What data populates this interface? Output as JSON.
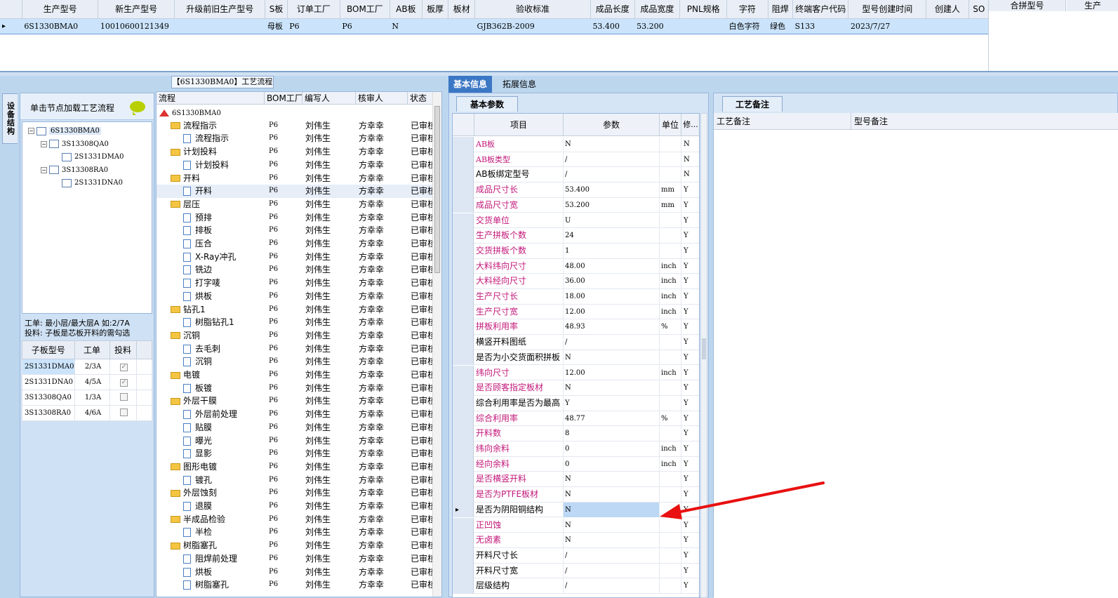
{
  "top_table": {
    "columns": [
      "生产型号",
      "新生产型号",
      "升级前旧生产型号",
      "S板",
      "订单工厂",
      "BOM工厂",
      "AB板",
      "板厚",
      "板材",
      "验收标准",
      "成品长度",
      "成品宽度",
      "PNL规格",
      "字符",
      "阻焊",
      "终端客户代码",
      "型号创建时间",
      "创建人",
      "SO"
    ],
    "row": [
      "6S1330BMA0",
      "10010600121349",
      "",
      "母板",
      "P6",
      "P6",
      "N",
      "",
      "",
      "GJB362B-2009",
      "53.400",
      "53.200",
      "",
      "白色字符",
      "绿色",
      "S133",
      "2023/7/27",
      "",
      ""
    ],
    "right_columns": [
      "合拼型号",
      "生产"
    ]
  },
  "left": {
    "side_tab": "设备结构",
    "hint": "单击节点加载工艺流程",
    "tree": [
      {
        "label": "6S1330BMA0",
        "level": 0
      },
      {
        "label": "3S13308QA0",
        "level": 1
      },
      {
        "label": "2S1331DMA0",
        "level": 2
      },
      {
        "label": "3S13308RA0",
        "level": 1
      },
      {
        "label": "2S1331DNA0",
        "level": 2
      }
    ],
    "note1": "工单: 最小层/最大层A 如:2/7A",
    "note2": "投料: 子板是芯板开料的需勾选",
    "sub_columns": [
      "子板型号",
      "工单",
      "投料"
    ],
    "sub_rows": [
      {
        "model": "2S1331DMA0",
        "order": "2/3A",
        "checked": true
      },
      {
        "model": "2S1331DNA0",
        "order": "4/5A",
        "checked": true
      },
      {
        "model": "3S13308QA0",
        "order": "1/3A",
        "checked": false
      },
      {
        "model": "3S13308RA0",
        "order": "4/6A",
        "checked": false
      }
    ]
  },
  "flow": {
    "title": "【6S1330BMA0】工艺流程",
    "columns": [
      "流程",
      "BOM工厂",
      "编写人",
      "核审人",
      "状态"
    ],
    "rows": [
      {
        "name": "6S1330BMA0",
        "type": "root",
        "bom": "",
        "writer": "",
        "reviewer": "",
        "status": ""
      },
      {
        "name": "流程指示",
        "type": "folder",
        "bom": "P6",
        "writer": "刘伟生",
        "reviewer": "方幸幸",
        "status": "已审核"
      },
      {
        "name": "流程指示",
        "type": "doc",
        "bom": "P6",
        "writer": "刘伟生",
        "reviewer": "方幸幸",
        "status": "已审核"
      },
      {
        "name": "计划投料",
        "type": "folder",
        "bom": "P6",
        "writer": "刘伟生",
        "reviewer": "方幸幸",
        "status": "已审核"
      },
      {
        "name": "计划投料",
        "type": "doc",
        "bom": "P6",
        "writer": "刘伟生",
        "reviewer": "方幸幸",
        "status": "已审核"
      },
      {
        "name": "开料",
        "type": "folder",
        "bom": "P6",
        "writer": "刘伟生",
        "reviewer": "方幸幸",
        "status": "已审核"
      },
      {
        "name": "开料",
        "type": "doc",
        "bom": "P6",
        "writer": "刘伟生",
        "reviewer": "方幸幸",
        "status": "已审核",
        "hl": true
      },
      {
        "name": "层压",
        "type": "folder",
        "bom": "P6",
        "writer": "刘伟生",
        "reviewer": "方幸幸",
        "status": "已审核"
      },
      {
        "name": "预排",
        "type": "doc",
        "bom": "P6",
        "writer": "刘伟生",
        "reviewer": "方幸幸",
        "status": "已审核"
      },
      {
        "name": "排板",
        "type": "doc",
        "bom": "P6",
        "writer": "刘伟生",
        "reviewer": "方幸幸",
        "status": "已审核"
      },
      {
        "name": "压合",
        "type": "doc",
        "bom": "P6",
        "writer": "刘伟生",
        "reviewer": "方幸幸",
        "status": "已审核"
      },
      {
        "name": "X-Ray冲孔",
        "type": "doc",
        "bom": "P6",
        "writer": "刘伟生",
        "reviewer": "方幸幸",
        "status": "已审核"
      },
      {
        "name": "铣边",
        "type": "doc",
        "bom": "P6",
        "writer": "刘伟生",
        "reviewer": "方幸幸",
        "status": "已审核"
      },
      {
        "name": "打字唛",
        "type": "doc",
        "bom": "P6",
        "writer": "刘伟生",
        "reviewer": "方幸幸",
        "status": "已审核"
      },
      {
        "name": "烘板",
        "type": "doc",
        "bom": "P6",
        "writer": "刘伟生",
        "reviewer": "方幸幸",
        "status": "已审核"
      },
      {
        "name": "钻孔1",
        "type": "folder",
        "bom": "P6",
        "writer": "刘伟生",
        "reviewer": "方幸幸",
        "status": "已审核"
      },
      {
        "name": "树脂钻孔1",
        "type": "doc",
        "bom": "P6",
        "writer": "刘伟生",
        "reviewer": "方幸幸",
        "status": "已审核"
      },
      {
        "name": "沉铜",
        "type": "folder",
        "bom": "P6",
        "writer": "刘伟生",
        "reviewer": "方幸幸",
        "status": "已审核"
      },
      {
        "name": "去毛刺",
        "type": "doc",
        "bom": "P6",
        "writer": "刘伟生",
        "reviewer": "方幸幸",
        "status": "已审核"
      },
      {
        "name": "沉铜",
        "type": "doc",
        "bom": "P6",
        "writer": "刘伟生",
        "reviewer": "方幸幸",
        "status": "已审核"
      },
      {
        "name": "电镀",
        "type": "folder",
        "bom": "P6",
        "writer": "刘伟生",
        "reviewer": "方幸幸",
        "status": "已审核"
      },
      {
        "name": "板镀",
        "type": "doc",
        "bom": "P6",
        "writer": "刘伟生",
        "reviewer": "方幸幸",
        "status": "已审核"
      },
      {
        "name": "外层干膜",
        "type": "folder",
        "bom": "P6",
        "writer": "刘伟生",
        "reviewer": "方幸幸",
        "status": "已审核"
      },
      {
        "name": "外层前处理",
        "type": "doc",
        "bom": "P6",
        "writer": "刘伟生",
        "reviewer": "方幸幸",
        "status": "已审核"
      },
      {
        "name": "贴膜",
        "type": "doc",
        "bom": "P6",
        "writer": "刘伟生",
        "reviewer": "方幸幸",
        "status": "已审核"
      },
      {
        "name": "曝光",
        "type": "doc",
        "bom": "P6",
        "writer": "刘伟生",
        "reviewer": "方幸幸",
        "status": "已审核"
      },
      {
        "name": "显影",
        "type": "doc",
        "bom": "P6",
        "writer": "刘伟生",
        "reviewer": "方幸幸",
        "status": "已审核"
      },
      {
        "name": "图形电镀",
        "type": "folder",
        "bom": "P6",
        "writer": "刘伟生",
        "reviewer": "方幸幸",
        "status": "已审核"
      },
      {
        "name": "镀孔",
        "type": "doc",
        "bom": "P6",
        "writer": "刘伟生",
        "reviewer": "方幸幸",
        "status": "已审核"
      },
      {
        "name": "外层蚀刻",
        "type": "folder",
        "bom": "P6",
        "writer": "刘伟生",
        "reviewer": "方幸幸",
        "status": "已审核"
      },
      {
        "name": "退膜",
        "type": "doc",
        "bom": "P6",
        "writer": "刘伟生",
        "reviewer": "方幸幸",
        "status": "已审核"
      },
      {
        "name": "半成品检验",
        "type": "folder",
        "bom": "P6",
        "writer": "刘伟生",
        "reviewer": "方幸幸",
        "status": "已审核"
      },
      {
        "name": "半检",
        "type": "doc",
        "bom": "P6",
        "writer": "刘伟生",
        "reviewer": "方幸幸",
        "status": "已审核"
      },
      {
        "name": "树脂塞孔",
        "type": "folder",
        "bom": "P6",
        "writer": "刘伟生",
        "reviewer": "方幸幸",
        "status": "已审核"
      },
      {
        "name": "阻焊前处理",
        "type": "doc",
        "bom": "P6",
        "writer": "刘伟生",
        "reviewer": "方幸幸",
        "status": "已审核"
      },
      {
        "name": "烘板",
        "type": "doc",
        "bom": "P6",
        "writer": "刘伟生",
        "reviewer": "方幸幸",
        "status": "已审核"
      },
      {
        "name": "树脂塞孔",
        "type": "doc",
        "bom": "P6",
        "writer": "刘伟生",
        "reviewer": "方幸幸",
        "status": "已审核"
      }
    ]
  },
  "right_tabs": [
    "基本信息",
    "拓展信息"
  ],
  "basic": {
    "subtab": "基本参数",
    "columns": [
      "项目",
      "参数",
      "单位",
      "修..."
    ],
    "rows": [
      {
        "k": "AB板",
        "v": "N",
        "u": "",
        "m": "N",
        "red": true
      },
      {
        "k": "AB板类型",
        "v": "/",
        "u": "",
        "m": "N",
        "red": true
      },
      {
        "k": "AB板绑定型号",
        "v": "/",
        "u": "",
        "m": "N",
        "red": false
      },
      {
        "k": "成品尺寸长",
        "v": "53.400",
        "u": "mm",
        "m": "Y",
        "red": true
      },
      {
        "k": "成品尺寸宽",
        "v": "53.200",
        "u": "mm",
        "m": "Y",
        "red": true
      },
      {
        "k": "交货单位",
        "v": "U",
        "u": "",
        "m": "Y",
        "red": true
      },
      {
        "k": "生产拼板个数",
        "v": "24",
        "u": "",
        "m": "Y",
        "red": true
      },
      {
        "k": "交货拼板个数",
        "v": "1",
        "u": "",
        "m": "Y",
        "red": true
      },
      {
        "k": "大料纬向尺寸",
        "v": "48.00",
        "u": "inch",
        "m": "Y",
        "red": true
      },
      {
        "k": "大料经向尺寸",
        "v": "36.00",
        "u": "inch",
        "m": "Y",
        "red": true
      },
      {
        "k": "生产尺寸长",
        "v": "18.00",
        "u": "inch",
        "m": "Y",
        "red": true
      },
      {
        "k": "生产尺寸宽",
        "v": "12.00",
        "u": "inch",
        "m": "Y",
        "red": true
      },
      {
        "k": "拼板利用率",
        "v": "48.93",
        "u": "%",
        "m": "Y",
        "red": true
      },
      {
        "k": "横竖开料图纸",
        "v": "/",
        "u": "",
        "m": "Y",
        "red": false
      },
      {
        "k": "是否为小交货面积拼板",
        "v": "N",
        "u": "",
        "m": "Y",
        "red": false
      },
      {
        "k": "纬向尺寸",
        "v": "12.00",
        "u": "inch",
        "m": "Y",
        "red": true
      },
      {
        "k": "是否顾客指定板材",
        "v": "N",
        "u": "",
        "m": "Y",
        "red": true
      },
      {
        "k": "综合利用率是否为最高",
        "v": "Y",
        "u": "",
        "m": "Y",
        "red": false
      },
      {
        "k": "综合利用率",
        "v": "48.77",
        "u": "%",
        "m": "Y",
        "red": true
      },
      {
        "k": "开料数",
        "v": "8",
        "u": "",
        "m": "Y",
        "red": true
      },
      {
        "k": "纬向余料",
        "v": "0",
        "u": "inch",
        "m": "Y",
        "red": true
      },
      {
        "k": "经向余料",
        "v": "0",
        "u": "inch",
        "m": "Y",
        "red": true
      },
      {
        "k": "是否横竖开料",
        "v": "N",
        "u": "",
        "m": "Y",
        "red": true
      },
      {
        "k": "是否为PTFE板材",
        "v": "N",
        "u": "",
        "m": "Y",
        "red": true
      },
      {
        "k": "是否为阴阳铜结构",
        "v": "N",
        "u": "",
        "m": "Y",
        "red": false,
        "active": true
      },
      {
        "k": "正凹蚀",
        "v": "N",
        "u": "",
        "m": "Y",
        "red": true
      },
      {
        "k": "无卤素",
        "v": "N",
        "u": "",
        "m": "Y",
        "red": true
      },
      {
        "k": "开料尺寸长",
        "v": "/",
        "u": "",
        "m": "Y",
        "red": false
      },
      {
        "k": "开料尺寸宽",
        "v": "/",
        "u": "",
        "m": "Y",
        "red": false
      },
      {
        "k": "层级结构",
        "v": "/",
        "u": "",
        "m": "Y",
        "red": false
      }
    ]
  },
  "craft": {
    "subtab": "工艺备注",
    "columns": [
      "工艺备注",
      "型号备注"
    ]
  },
  "colors": {
    "accent": "#3b77c4",
    "selection": "#cbe4fb",
    "red_label": "#c2187a",
    "arrow": "#e81010"
  }
}
